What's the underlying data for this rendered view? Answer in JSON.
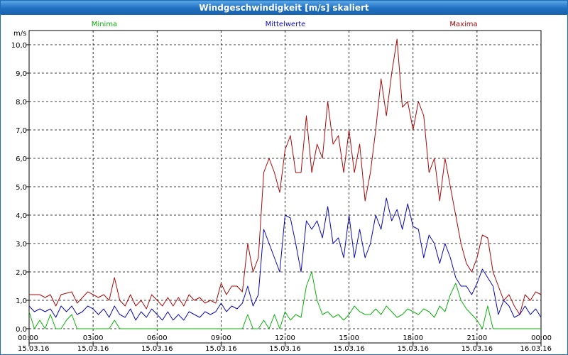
{
  "window": {
    "title": "Windgeschwindigkeit [m/s] skaliert"
  },
  "legend": {
    "min": {
      "label": "Minima",
      "color": "#0ab00a"
    },
    "mean": {
      "label": "Mittelwerte",
      "color": "#0a0ab4"
    },
    "max": {
      "label": "Maxima",
      "color": "#a80a0a"
    }
  },
  "chart_data": {
    "type": "line",
    "ylabel": "m/s",
    "ylim": [
      -0.5,
      10.5
    ],
    "xlim": [
      0,
      24
    ],
    "grid": true,
    "legend_position": "top",
    "y_ticks": [
      "0,0",
      "1,0",
      "2,0",
      "3,0",
      "4,0",
      "5,0",
      "6,0",
      "7,0",
      "8,0",
      "9,0",
      "10,0"
    ],
    "x_ticks": [
      {
        "time": "00:00",
        "date": "15.03.16"
      },
      {
        "time": "03:00",
        "date": "15.03.16"
      },
      {
        "time": "06:00",
        "date": "15.03.16"
      },
      {
        "time": "09:00",
        "date": "15.03.16"
      },
      {
        "time": "12:00",
        "date": "15.03.16"
      },
      {
        "time": "15:00",
        "date": "15.03.16"
      },
      {
        "time": "18:00",
        "date": "15.03.16"
      },
      {
        "time": "21:00",
        "date": "15.03.16"
      },
      {
        "time": "00:00",
        "date": "16.03.16"
      }
    ],
    "series": [
      {
        "name": "Maxima",
        "color": "#a80a0a",
        "points": [
          [
            0,
            1.2
          ],
          [
            0.5,
            1.2
          ],
          [
            0.75,
            1.1
          ],
          [
            1,
            1.2
          ],
          [
            1.25,
            0.8
          ],
          [
            1.5,
            1.2
          ],
          [
            2,
            1.3
          ],
          [
            2.25,
            0.9
          ],
          [
            2.5,
            1.1
          ],
          [
            2.75,
            1.3
          ],
          [
            3,
            1.2
          ],
          [
            3.25,
            1.1
          ],
          [
            3.5,
            1.2
          ],
          [
            3.75,
            1
          ],
          [
            4,
            1.8
          ],
          [
            4.25,
            1
          ],
          [
            4.5,
            0.8
          ],
          [
            4.75,
            1.2
          ],
          [
            5,
            0.8
          ],
          [
            5.25,
            1
          ],
          [
            5.5,
            0.7
          ],
          [
            5.75,
            1.2
          ],
          [
            6,
            1
          ],
          [
            6.25,
            0.8
          ],
          [
            6.5,
            1.1
          ],
          [
            6.75,
            0.8
          ],
          [
            7,
            1.1
          ],
          [
            7.25,
            0.8
          ],
          [
            7.5,
            1.2
          ],
          [
            7.75,
            1
          ],
          [
            8,
            1.1
          ],
          [
            8.25,
            0.9
          ],
          [
            8.5,
            1
          ],
          [
            8.75,
            0.9
          ],
          [
            9,
            1.6
          ],
          [
            9.25,
            1.2
          ],
          [
            9.5,
            1.5
          ],
          [
            9.75,
            1.5
          ],
          [
            10,
            1.3
          ],
          [
            10.25,
            3
          ],
          [
            10.5,
            2
          ],
          [
            10.75,
            2.5
          ],
          [
            11,
            5.5
          ],
          [
            11.25,
            6
          ],
          [
            11.5,
            5.5
          ],
          [
            11.75,
            4.8
          ],
          [
            12,
            6.3
          ],
          [
            12.25,
            6.8
          ],
          [
            12.5,
            5.5
          ],
          [
            12.75,
            5.5
          ],
          [
            13,
            7.5
          ],
          [
            13.25,
            5.5
          ],
          [
            13.5,
            6.5
          ],
          [
            13.75,
            6
          ],
          [
            14,
            8
          ],
          [
            14.25,
            6.5
          ],
          [
            14.5,
            6.8
          ],
          [
            14.75,
            5.5
          ],
          [
            15,
            7
          ],
          [
            15.25,
            5.5
          ],
          [
            15.5,
            6.5
          ],
          [
            15.75,
            4.5
          ],
          [
            16,
            5.5
          ],
          [
            16.25,
            7
          ],
          [
            16.5,
            8.8
          ],
          [
            16.75,
            7.5
          ],
          [
            17,
            9
          ],
          [
            17.25,
            10.2
          ],
          [
            17.5,
            7.8
          ],
          [
            17.75,
            8
          ],
          [
            18,
            7
          ],
          [
            18.25,
            8
          ],
          [
            18.5,
            7.5
          ],
          [
            18.75,
            5.5
          ],
          [
            19,
            6
          ],
          [
            19.25,
            4.5
          ],
          [
            19.5,
            6
          ],
          [
            19.75,
            5
          ],
          [
            20,
            4
          ],
          [
            20.25,
            3
          ],
          [
            20.5,
            2.3
          ],
          [
            20.75,
            2
          ],
          [
            21,
            2.5
          ],
          [
            21.25,
            3.3
          ],
          [
            21.5,
            3.2
          ],
          [
            21.75,
            2
          ],
          [
            22,
            1.5
          ],
          [
            22.25,
            1
          ],
          [
            22.5,
            1.2
          ],
          [
            22.75,
            0.8
          ],
          [
            23,
            0.5
          ],
          [
            23.25,
            1.2
          ],
          [
            23.5,
            1
          ],
          [
            23.75,
            1.3
          ],
          [
            24,
            1.2
          ]
        ]
      },
      {
        "name": "Mittelwerte",
        "color": "#0a0ab4",
        "points": [
          [
            0,
            0.8
          ],
          [
            0.25,
            0.6
          ],
          [
            0.5,
            0.7
          ],
          [
            0.75,
            0.6
          ],
          [
            1,
            0.7
          ],
          [
            1.25,
            0.4
          ],
          [
            1.5,
            0.8
          ],
          [
            1.75,
            0.6
          ],
          [
            2,
            0.8
          ],
          [
            2.25,
            0.5
          ],
          [
            2.5,
            0.6
          ],
          [
            2.75,
            0.8
          ],
          [
            3,
            0.7
          ],
          [
            3.25,
            0.5
          ],
          [
            3.5,
            0.7
          ],
          [
            3.75,
            0.4
          ],
          [
            4,
            0.8
          ],
          [
            4.25,
            0.5
          ],
          [
            4.5,
            0.4
          ],
          [
            4.75,
            0.7
          ],
          [
            5,
            0.3
          ],
          [
            5.25,
            0.6
          ],
          [
            5.5,
            0.4
          ],
          [
            5.75,
            0.7
          ],
          [
            6,
            0.5
          ],
          [
            6.25,
            0.3
          ],
          [
            6.5,
            0.6
          ],
          [
            6.75,
            0.3
          ],
          [
            7,
            0.5
          ],
          [
            7.25,
            0.3
          ],
          [
            7.5,
            0.6
          ],
          [
            7.75,
            0.5
          ],
          [
            8,
            0.4
          ],
          [
            8.25,
            0.6
          ],
          [
            8.5,
            0.5
          ],
          [
            8.75,
            0.6
          ],
          [
            9,
            0.9
          ],
          [
            9.25,
            0.6
          ],
          [
            9.5,
            0.8
          ],
          [
            9.75,
            0.7
          ],
          [
            10,
            0.9
          ],
          [
            10.25,
            1.5
          ],
          [
            10.5,
            0.8
          ],
          [
            10.75,
            1.2
          ],
          [
            11,
            3.5
          ],
          [
            11.25,
            3
          ],
          [
            11.5,
            2.5
          ],
          [
            11.75,
            2
          ],
          [
            12,
            4
          ],
          [
            12.25,
            3.9
          ],
          [
            12.5,
            3
          ],
          [
            12.75,
            2
          ],
          [
            13,
            3.8
          ],
          [
            13.25,
            3.5
          ],
          [
            13.5,
            3.8
          ],
          [
            13.75,
            3.2
          ],
          [
            14,
            4.3
          ],
          [
            14.25,
            3
          ],
          [
            14.5,
            3.2
          ],
          [
            14.75,
            2.5
          ],
          [
            15,
            4
          ],
          [
            15.25,
            2.5
          ],
          [
            15.5,
            3.5
          ],
          [
            15.75,
            2.5
          ],
          [
            16,
            3
          ],
          [
            16.25,
            4
          ],
          [
            16.5,
            3.5
          ],
          [
            16.75,
            4.6
          ],
          [
            17,
            3.8
          ],
          [
            17.25,
            4.2
          ],
          [
            17.5,
            3.5
          ],
          [
            17.75,
            4.4
          ],
          [
            18,
            3.6
          ],
          [
            18.25,
            3.5
          ],
          [
            18.5,
            2.5
          ],
          [
            18.75,
            3.3
          ],
          [
            19,
            3
          ],
          [
            19.25,
            2.3
          ],
          [
            19.5,
            3
          ],
          [
            19.75,
            2.5
          ],
          [
            20,
            1.8
          ],
          [
            20.25,
            1.5
          ],
          [
            20.5,
            1.5
          ],
          [
            20.75,
            1.2
          ],
          [
            21,
            1.6
          ],
          [
            21.25,
            2.1
          ],
          [
            21.5,
            1.8
          ],
          [
            21.75,
            1.5
          ],
          [
            22,
            0.5
          ],
          [
            22.25,
            1
          ],
          [
            22.5,
            0.8
          ],
          [
            22.75,
            0.4
          ],
          [
            23,
            0.5
          ],
          [
            23.25,
            0.8
          ],
          [
            23.5,
            0.5
          ],
          [
            23.75,
            0.7
          ],
          [
            24,
            0.4
          ]
        ]
      },
      {
        "name": "Minima",
        "color": "#0ab00a",
        "points": [
          [
            0,
            0.6
          ],
          [
            0.25,
            0
          ],
          [
            0.5,
            0.3
          ],
          [
            0.75,
            0
          ],
          [
            1,
            0.5
          ],
          [
            1.25,
            0
          ],
          [
            1.5,
            0
          ],
          [
            1.75,
            0.3
          ],
          [
            2,
            0.5
          ],
          [
            2.25,
            0
          ],
          [
            2.5,
            0
          ],
          [
            2.75,
            0
          ],
          [
            3,
            0
          ],
          [
            3.25,
            0
          ],
          [
            3.5,
            0
          ],
          [
            3.75,
            0
          ],
          [
            4,
            0.3
          ],
          [
            4.25,
            0
          ],
          [
            4.5,
            0
          ],
          [
            4.75,
            0
          ],
          [
            5,
            0
          ],
          [
            5.25,
            0
          ],
          [
            5.5,
            0
          ],
          [
            5.75,
            0
          ],
          [
            6,
            0
          ],
          [
            6.25,
            0
          ],
          [
            6.5,
            0
          ],
          [
            6.75,
            0
          ],
          [
            7,
            0
          ],
          [
            7.25,
            0
          ],
          [
            7.5,
            0
          ],
          [
            7.75,
            0
          ],
          [
            8,
            0
          ],
          [
            8.25,
            0
          ],
          [
            8.5,
            0
          ],
          [
            8.75,
            0
          ],
          [
            9,
            0
          ],
          [
            9.25,
            0
          ],
          [
            9.5,
            0
          ],
          [
            9.75,
            0
          ],
          [
            10,
            0
          ],
          [
            10.25,
            0.5
          ],
          [
            10.5,
            0
          ],
          [
            10.75,
            0
          ],
          [
            11,
            0.3
          ],
          [
            11.25,
            0
          ],
          [
            11.5,
            0.5
          ],
          [
            11.75,
            0
          ],
          [
            12,
            0.6
          ],
          [
            12.25,
            0.3
          ],
          [
            12.5,
            0.5
          ],
          [
            12.75,
            0.4
          ],
          [
            13,
            1.5
          ],
          [
            13.25,
            2
          ],
          [
            13.5,
            1
          ],
          [
            13.75,
            0.5
          ],
          [
            14,
            0.6
          ],
          [
            14.25,
            0.4
          ],
          [
            14.5,
            0.5
          ],
          [
            14.75,
            0.3
          ],
          [
            15,
            0.5
          ],
          [
            15.25,
            0.8
          ],
          [
            15.5,
            0.6
          ],
          [
            15.75,
            0.5
          ],
          [
            16,
            0.5
          ],
          [
            16.25,
            0.7
          ],
          [
            16.5,
            0.5
          ],
          [
            16.75,
            0.8
          ],
          [
            17,
            0.6
          ],
          [
            17.25,
            0.4
          ],
          [
            17.5,
            0.5
          ],
          [
            17.75,
            0.7
          ],
          [
            18,
            0.6
          ],
          [
            18.25,
            0.5
          ],
          [
            18.5,
            0.7
          ],
          [
            18.75,
            0.6
          ],
          [
            19,
            0.4
          ],
          [
            19.25,
            0.8
          ],
          [
            19.5,
            0.6
          ],
          [
            19.75,
            1.2
          ],
          [
            20,
            1.6
          ],
          [
            20.25,
            1
          ],
          [
            20.5,
            0.7
          ],
          [
            20.75,
            0.5
          ],
          [
            21,
            0.3
          ],
          [
            21.25,
            0
          ],
          [
            21.5,
            0.8
          ],
          [
            21.75,
            0
          ],
          [
            22,
            0
          ],
          [
            22.25,
            0
          ],
          [
            22.5,
            0
          ],
          [
            22.75,
            0
          ],
          [
            23,
            0
          ],
          [
            23.25,
            0
          ],
          [
            23.5,
            0
          ],
          [
            23.75,
            0
          ],
          [
            24,
            0
          ]
        ]
      }
    ]
  }
}
